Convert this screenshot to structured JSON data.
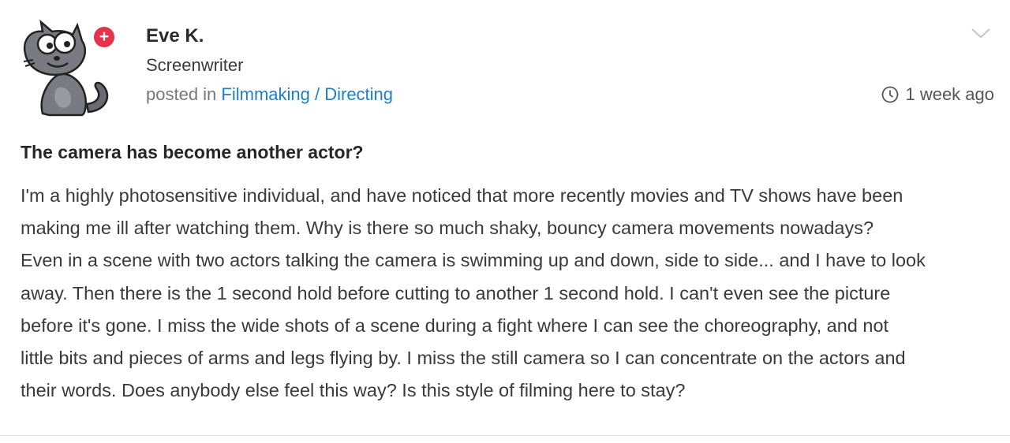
{
  "author": {
    "name": "Eve K.",
    "role": "Screenwriter",
    "avatar_icon": "cartoon-cat-avatar",
    "badge_symbol": "+",
    "badge_color": "#e5334b"
  },
  "posted": {
    "prefix": "posted in",
    "category": "Filmmaking / Directing",
    "time": "1 week ago",
    "time_icon": "clock-icon"
  },
  "menu": {
    "icon": "chevron-down-icon"
  },
  "post": {
    "title": "The camera has become another actor?",
    "lines": [
      "I'm a highly photosensitive individual, and have noticed that more recently movies and TV shows have been",
      "making me ill after watching them.  Why is there so much shaky, bouncy camera movements nowadays?",
      "Even in a scene with two actors talking the camera is swimming up and down, side to side... and I have to look",
      "away.  Then there is the 1 second hold before cutting to another 1 second hold.  I can't even see the picture",
      "before it's gone.  I miss the wide shots of a scene during a fight where I can see the choreography, and not",
      "little bits and pieces of arms and legs flying by.   I miss the still camera so I can concentrate on the actors and",
      "their words. Does anybody else feel this way?  Is this style of filming here to stay?"
    ]
  },
  "colors": {
    "link": "#1f7ec4",
    "muted_text": "#777777"
  }
}
